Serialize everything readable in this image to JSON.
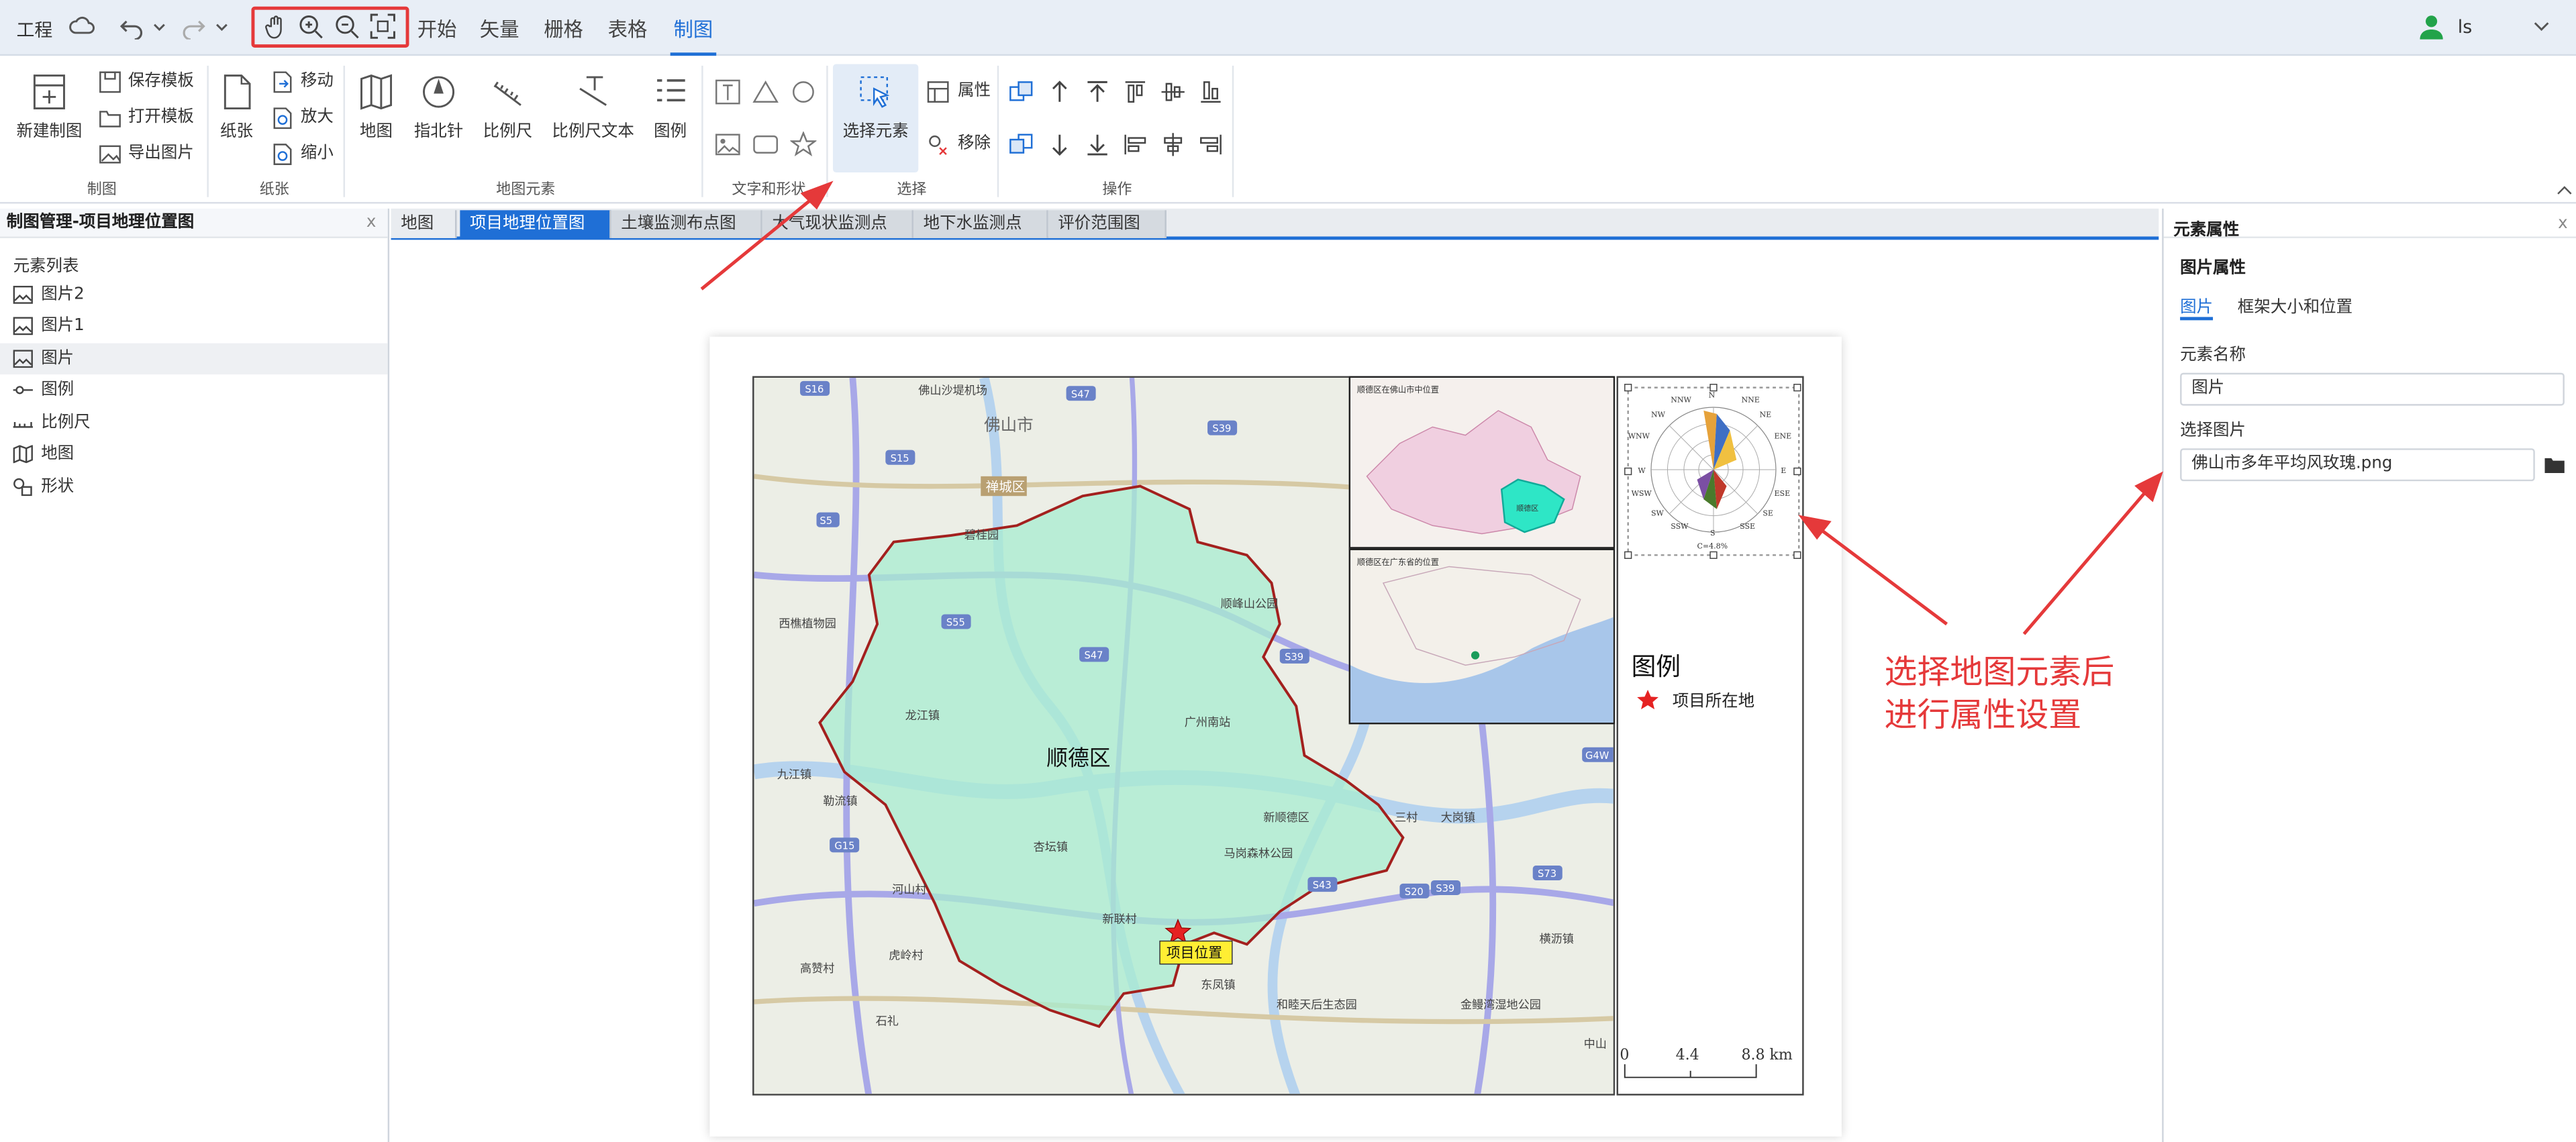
{
  "topbar": {
    "project_label": "工程",
    "menus": [
      "开始",
      "矢量",
      "栅格",
      "表格",
      "制图"
    ],
    "user": "ls"
  },
  "ribbon": {
    "new_map": "新建制图",
    "save_template": "保存模板",
    "open_template": "打开模板",
    "export_image": "导出图片",
    "group_map": "制图",
    "paper": "纸张",
    "move": "移动",
    "zoom_in": "放大",
    "zoom_out": "缩小",
    "group_paper": "纸张",
    "map": "地图",
    "north_arrow": "指北针",
    "scale_bar": "比例尺",
    "scale_text": "比例尺文本",
    "legend": "图例",
    "group_elements": "地图元素",
    "group_text_shape": "文字和形状",
    "select_element": "选择元素",
    "properties": "属性",
    "remove": "移除",
    "group_select": "选择",
    "group_ops": "操作"
  },
  "left_panel": {
    "title": "制图管理-项目地理位置图",
    "list_title": "元素列表",
    "items": [
      "图片2",
      "图片1",
      "图片",
      "图例",
      "比例尺",
      "地图",
      "形状"
    ]
  },
  "tabs": [
    {
      "label": "地图"
    },
    {
      "label": "项目地理位置图"
    },
    {
      "label": "土壤监测布点图"
    },
    {
      "label": "大气现状监测点"
    },
    {
      "label": "地下水监测点"
    },
    {
      "label": "评价范围图"
    }
  ],
  "map": {
    "district": "顺德区",
    "project_label": "项目位置",
    "city": "佛山市",
    "chancheng": "禅城区",
    "places": [
      "佛山沙堤机场",
      "西樵植物园",
      "九江镇",
      "龙江镇",
      "勒流镇",
      "杏坛镇",
      "河山村",
      "虎岭村",
      "石礼",
      "高赞村",
      "新联村",
      "东凤镇",
      "和睦天后生态园",
      "金鳗湾湿地公园",
      "三村",
      "大岗镇",
      "横沥镇",
      "中山",
      "新顺德区",
      "马岗森林公园",
      "顺峰山公园",
      "广州南站",
      "碧桂园"
    ],
    "road_labels": [
      "S16",
      "S47",
      "S39",
      "S15",
      "S5",
      "S55",
      "S47",
      "S39",
      "G15",
      "S43",
      "S20",
      "S39",
      "S73",
      "G4W"
    ],
    "inset1_title": "顺德区在佛山市中位置",
    "inset2_title": "顺德区在广东省的位置",
    "inset1_label": "顺德区"
  },
  "legend": {
    "title": "图例",
    "item": "项目所在地",
    "scale_ticks": [
      "0",
      "4.4",
      "8.8 km"
    ],
    "rose_dirs": [
      "N",
      "NNE",
      "NE",
      "ENE",
      "E",
      "ESE",
      "SE",
      "SSE",
      "S",
      "SSW",
      "SW",
      "WSW",
      "W",
      "WNW",
      "NW",
      "NNW"
    ],
    "calm": "C=4.8%"
  },
  "right_panel": {
    "title": "元素属性",
    "subtitle": "图片属性",
    "tab_image": "图片",
    "tab_frame": "框架大小和位置",
    "name_label": "元素名称",
    "name_value": "图片",
    "select_label": "选择图片",
    "select_value": "佛山市多年平均风玫瑰.png"
  },
  "annotation": {
    "line1": "选择地图元素后",
    "line2": "进行属性设置"
  },
  "colors": {
    "accent": "#1f6fd6",
    "annotation": "#e5393a",
    "district_fill": "#a8ecd0",
    "boundary": "#a3201e"
  }
}
